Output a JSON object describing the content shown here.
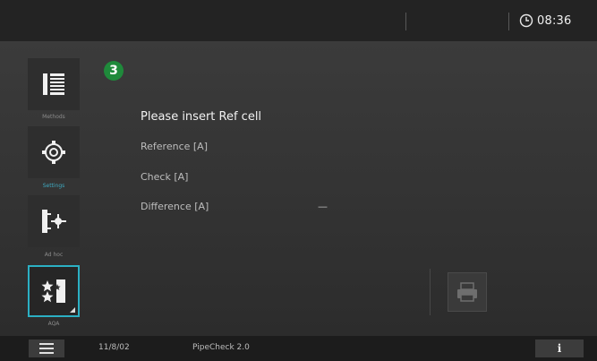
{
  "header": {
    "time": "08:36"
  },
  "sidebar": {
    "items": [
      {
        "label": "Methods",
        "icon": "methods-list-icon"
      },
      {
        "label": "Settings",
        "icon": "gear-icon"
      },
      {
        "label": "Ad hoc",
        "icon": "ad-hoc-measure-icon"
      },
      {
        "label": "AQA",
        "icon": "aqa-stars-icon",
        "active": true
      }
    ]
  },
  "main": {
    "step_number": "3",
    "prompt": "Please insert Ref cell",
    "rows": [
      {
        "label": "Reference [A]",
        "value": ""
      },
      {
        "label": "Check [A]",
        "value": ""
      },
      {
        "label": "Difference [A]",
        "value": "—"
      }
    ],
    "print_icon": "printer-icon"
  },
  "footer": {
    "menu_icon": "hamburger-menu-icon",
    "serial": "11/8/02",
    "product": "PipeCheck 2.0",
    "info_label": "i"
  },
  "colors": {
    "accent": "#2bb0c4",
    "step_badge": "#1f8a3b",
    "background": "#333333"
  }
}
